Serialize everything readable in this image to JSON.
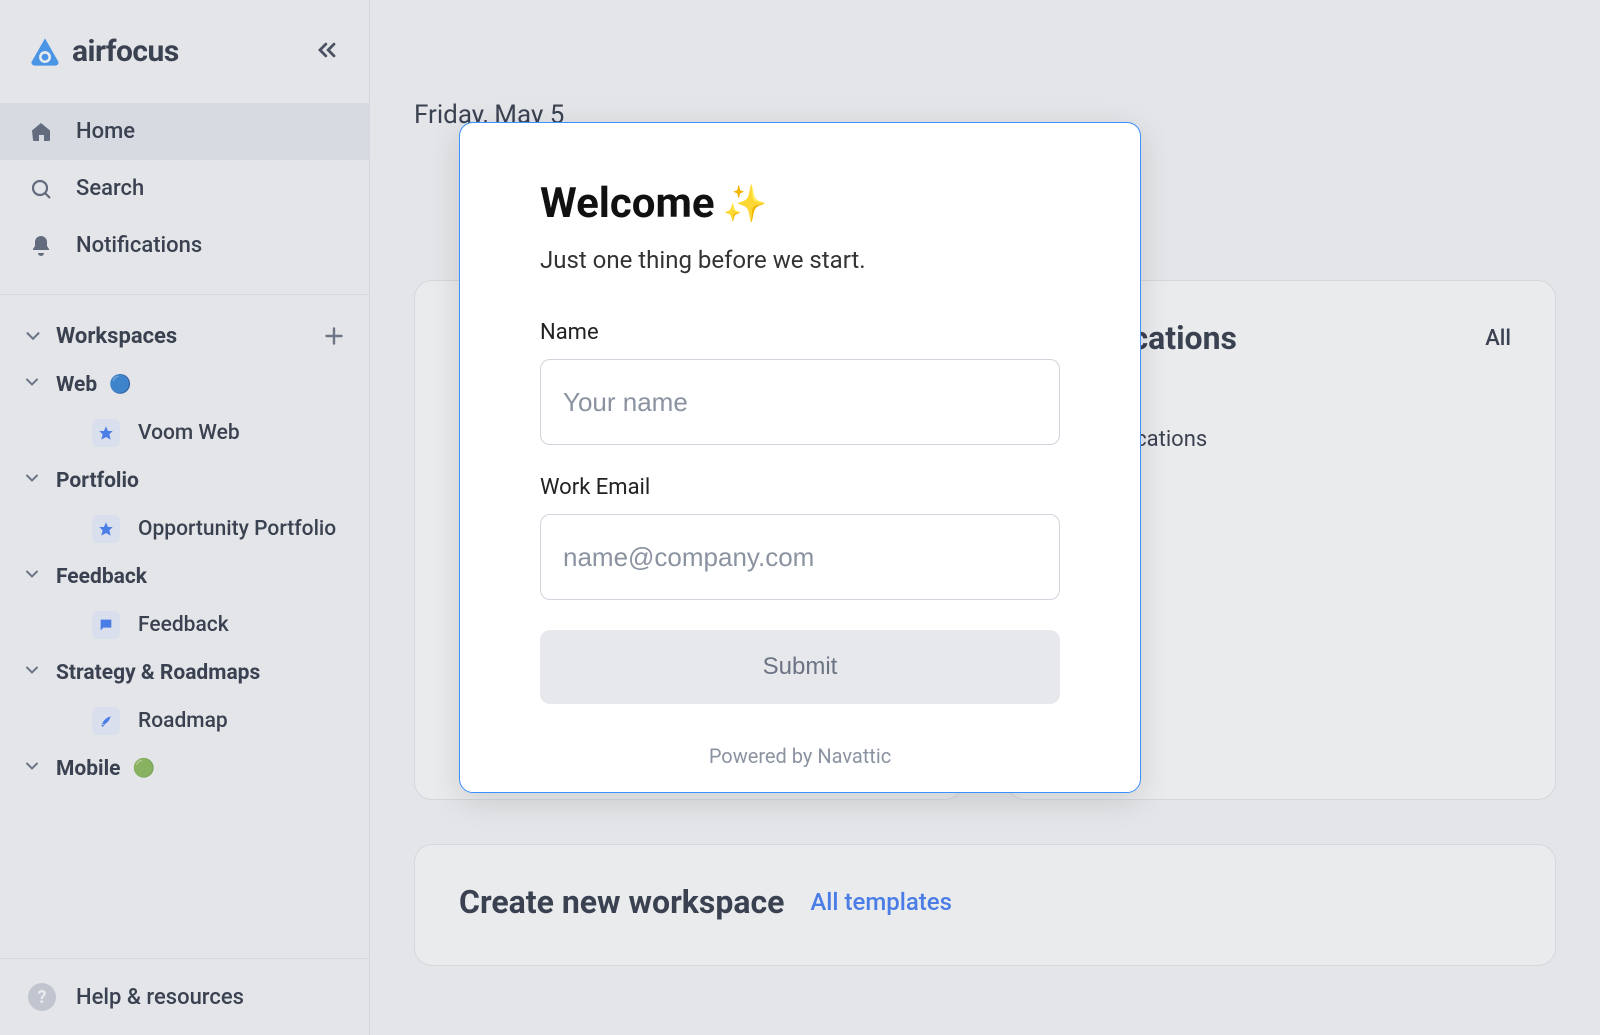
{
  "brand": {
    "name": "airfocus"
  },
  "nav": {
    "home": "Home",
    "search": "Search",
    "notifications": "Notifications"
  },
  "workspaces": {
    "title": "Workspaces",
    "groups": [
      {
        "label": "Web",
        "dot": "🔵",
        "children": [
          {
            "label": "Voom Web",
            "icon": "star"
          }
        ]
      },
      {
        "label": "Portfolio",
        "children": [
          {
            "label": "Opportunity Portfolio",
            "icon": "star"
          }
        ]
      },
      {
        "label": "Feedback",
        "children": [
          {
            "label": "Feedback",
            "icon": "chat"
          }
        ]
      },
      {
        "label": "Strategy & Roadmaps",
        "children": [
          {
            "label": "Roadmap",
            "icon": "rocket"
          }
        ]
      },
      {
        "label": "Mobile",
        "dot": "🟢",
        "children": []
      }
    ]
  },
  "footer": {
    "help": "Help & resources"
  },
  "main": {
    "date": "Friday, May 5",
    "notif_card": {
      "title": "Notifications",
      "link": "All",
      "empty": "No notifications"
    },
    "create_card": {
      "title": "Create new workspace",
      "link": "All templates"
    }
  },
  "modal": {
    "title": "Welcome",
    "title_emoji": "✨",
    "subtitle": "Just one thing before we start.",
    "name_label": "Name",
    "name_placeholder": "Your name",
    "email_label": "Work Email",
    "email_placeholder": "name@company.com",
    "submit": "Submit",
    "powered": "Powered by Navattic"
  }
}
